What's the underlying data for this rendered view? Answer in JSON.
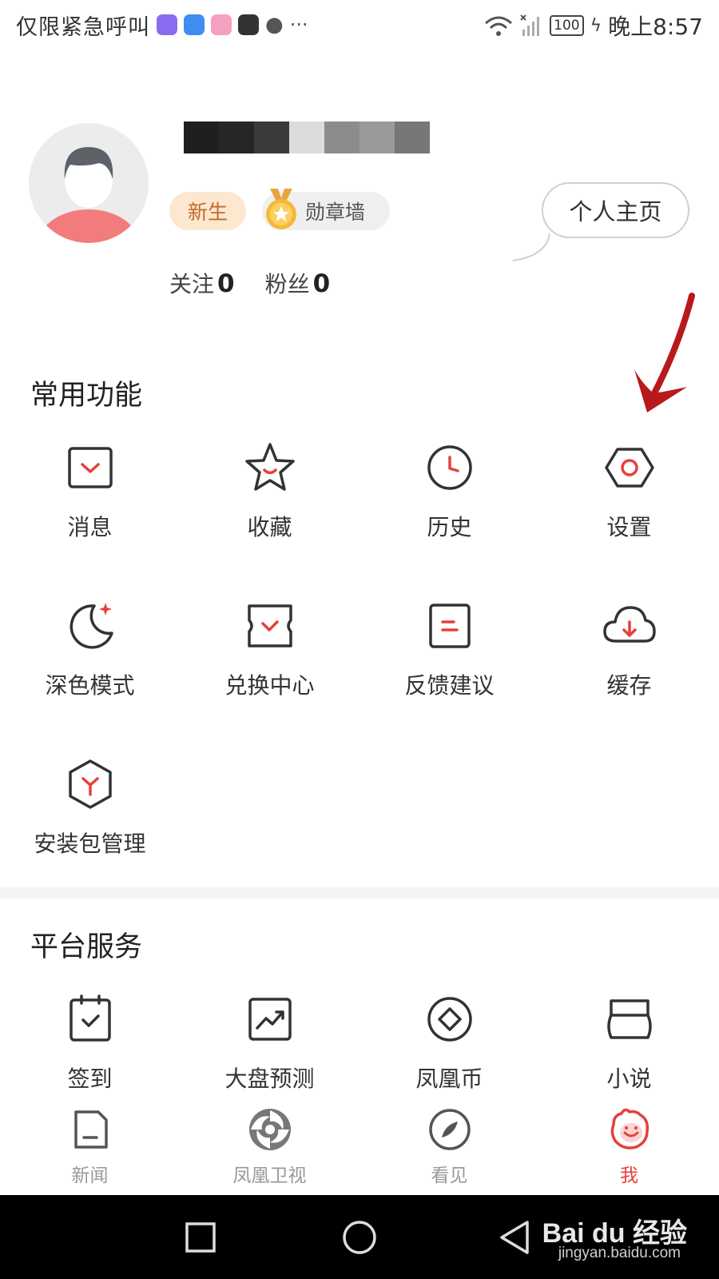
{
  "status_bar": {
    "carrier": "仅限紧急呼叫",
    "more": "···",
    "battery": "100",
    "time": "晚上8:57"
  },
  "profile": {
    "badge_new": "新生",
    "medal_wall": "勋章墙",
    "homepage_button": "个人主页",
    "follow_label": "关注",
    "follow_count": "0",
    "fans_label": "粉丝",
    "fans_count": "0"
  },
  "common_functions": {
    "title": "常用功能",
    "items": [
      {
        "label": "消息",
        "icon": "message-icon"
      },
      {
        "label": "收藏",
        "icon": "star-icon"
      },
      {
        "label": "历史",
        "icon": "clock-icon"
      },
      {
        "label": "设置",
        "icon": "hexagon-settings-icon"
      },
      {
        "label": "深色模式",
        "icon": "moon-icon"
      },
      {
        "label": "兑换中心",
        "icon": "ticket-icon"
      },
      {
        "label": "反馈建议",
        "icon": "feedback-icon"
      },
      {
        "label": "缓存",
        "icon": "cloud-download-icon"
      },
      {
        "label": "安装包管理",
        "icon": "package-icon"
      }
    ]
  },
  "platform_services": {
    "title": "平台服务",
    "items": [
      {
        "label": "签到",
        "icon": "checkin-icon"
      },
      {
        "label": "大盘预测",
        "icon": "trend-chart-icon"
      },
      {
        "label": "凤凰币",
        "icon": "coin-icon"
      },
      {
        "label": "小说",
        "icon": "book-icon"
      }
    ]
  },
  "bottom_nav": {
    "items": [
      {
        "label": "新闻",
        "icon": "news-icon"
      },
      {
        "label": "凤凰卫视",
        "icon": "phoenix-tv-icon"
      },
      {
        "label": "看见",
        "icon": "compass-icon"
      },
      {
        "label": "我",
        "icon": "me-icon"
      }
    ],
    "active_index": 3,
    "active_color": "#e6403a"
  },
  "watermark": {
    "brand": "Bai du 经验",
    "url": "jingyan.baidu.com"
  },
  "colors": {
    "accent_red": "#e6403a",
    "arrow_red": "#b8191a"
  }
}
